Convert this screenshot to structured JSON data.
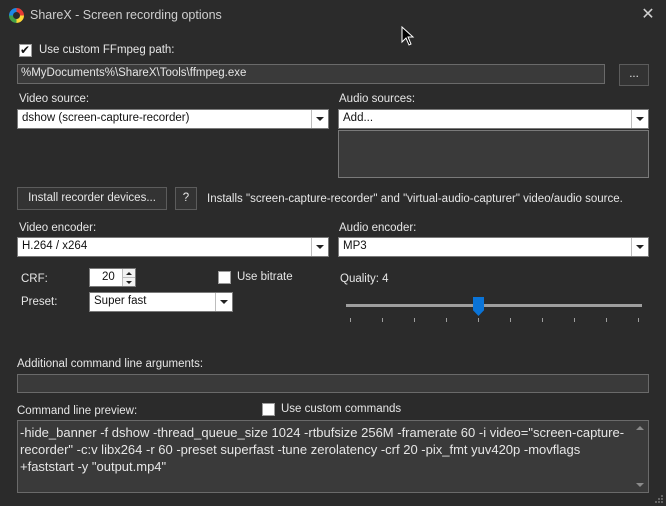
{
  "window": {
    "title": "ShareX - Screen recording options",
    "close_glyph": "✕",
    "icon": "sharex-logo-icon"
  },
  "ffmpeg": {
    "use_custom_path_label": "Use custom FFmpeg path:",
    "use_custom_path_checked": true,
    "path_value": "%MyDocuments%\\ShareX\\Tools\\ffmpeg.exe",
    "browse_label": "..."
  },
  "video_source": {
    "label": "Video source:",
    "selected": "dshow (screen-capture-recorder)"
  },
  "audio_sources": {
    "label": "Audio sources:",
    "selected": "Add..."
  },
  "install": {
    "button_label": "Install recorder devices...",
    "help_label": "?",
    "description": "Installs \"screen-capture-recorder\" and \"virtual-audio-capturer\" video/audio source."
  },
  "video_encoder": {
    "label": "Video encoder:",
    "selected": "H.264 / x264"
  },
  "audio_encoder": {
    "label": "Audio encoder:",
    "selected": "MP3"
  },
  "crf": {
    "label": "CRF:",
    "value": "20"
  },
  "use_bitrate": {
    "label": "Use bitrate",
    "checked": false
  },
  "preset": {
    "label": "Preset:",
    "selected": "Super fast"
  },
  "quality": {
    "label": "Quality: 4",
    "value": 4,
    "min": 0,
    "max": 9
  },
  "additional_args": {
    "label": "Additional command line arguments:",
    "value": ""
  },
  "preview": {
    "label": "Command line preview:",
    "use_custom_commands_label": "Use custom commands",
    "use_custom_commands_checked": false,
    "text": "-hide_banner -f dshow -thread_queue_size 1024 -rtbufsize 256M -framerate 60 -i video=\"screen-capture-recorder\" -c:v libx264 -r 60 -preset superfast -tune zerolatency -crf 20 -pix_fmt yuv420p -movflags +faststart -y \"output.mp4\""
  },
  "colors": {
    "background": "#2b2b2b",
    "accent": "#0a74d8"
  }
}
